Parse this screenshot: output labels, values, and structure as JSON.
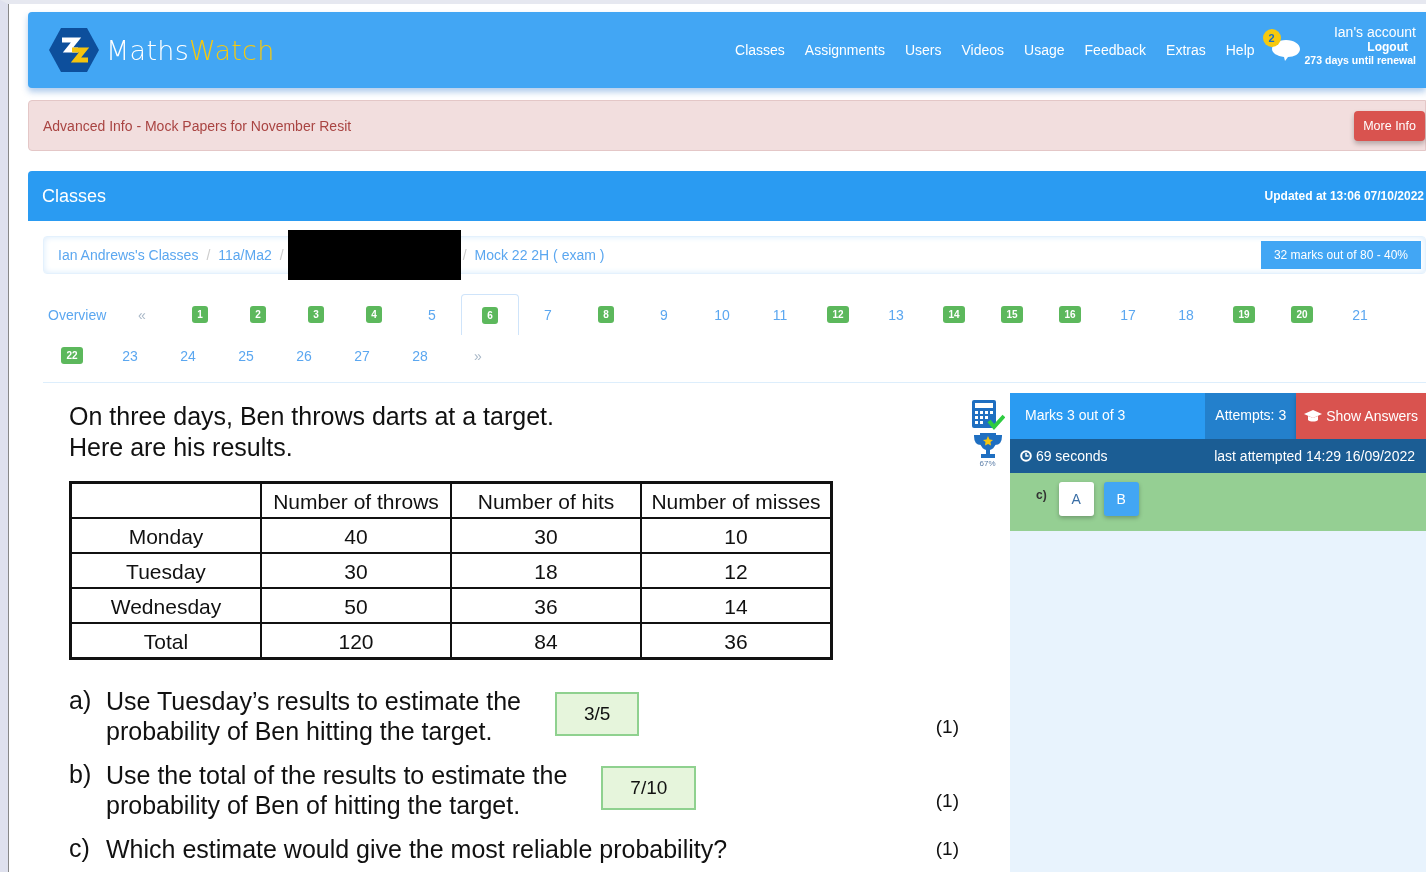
{
  "navbar": {
    "logo_left": "Maths",
    "logo_right": "Watch",
    "links": [
      "Classes",
      "Assignments",
      "Users",
      "Videos",
      "Usage",
      "Feedback",
      "Extras",
      "Help"
    ],
    "message_count": "2",
    "account": "Ian's account",
    "logout": "Logout",
    "renewal": "273 days until renewal"
  },
  "alert": {
    "text": "Advanced Info - Mock Papers for November Resit",
    "button": "More Info"
  },
  "panel": {
    "title": "Classes",
    "updated": "Updated at 13:06 07/10/2022"
  },
  "breadcrumb": {
    "separator": "/",
    "items": [
      "Ian Andrews's Classes",
      "11a/Ma2",
      "Mock 22 2H ( exam )"
    ],
    "score": "32 marks out of 80 - 40%"
  },
  "pagination": {
    "overview": "Overview",
    "prev": "«",
    "next": "»",
    "questions": [
      {
        "label": "1",
        "answered": true,
        "selected": false
      },
      {
        "label": "2",
        "answered": true,
        "selected": false
      },
      {
        "label": "3",
        "answered": true,
        "selected": false
      },
      {
        "label": "4",
        "answered": true,
        "selected": false
      },
      {
        "label": "5",
        "answered": false,
        "selected": false
      },
      {
        "label": "6",
        "answered": true,
        "selected": true
      },
      {
        "label": "7",
        "answered": false,
        "selected": false
      },
      {
        "label": "8",
        "answered": true,
        "selected": false
      },
      {
        "label": "9",
        "answered": false,
        "selected": false
      },
      {
        "label": "10",
        "answered": false,
        "selected": false
      },
      {
        "label": "11",
        "answered": false,
        "selected": false
      },
      {
        "label": "12",
        "answered": true,
        "selected": false
      },
      {
        "label": "13",
        "answered": false,
        "selected": false
      },
      {
        "label": "14",
        "answered": true,
        "selected": false
      },
      {
        "label": "15",
        "answered": true,
        "selected": false
      },
      {
        "label": "16",
        "answered": true,
        "selected": false
      },
      {
        "label": "17",
        "answered": false,
        "selected": false
      },
      {
        "label": "18",
        "answered": false,
        "selected": false
      },
      {
        "label": "19",
        "answered": true,
        "selected": false
      },
      {
        "label": "20",
        "answered": true,
        "selected": false
      },
      {
        "label": "21",
        "answered": false,
        "selected": false
      },
      {
        "label": "22",
        "answered": true,
        "selected": false
      },
      {
        "label": "23",
        "answered": false,
        "selected": false
      },
      {
        "label": "24",
        "answered": false,
        "selected": false
      },
      {
        "label": "25",
        "answered": false,
        "selected": false
      },
      {
        "label": "26",
        "answered": false,
        "selected": false
      },
      {
        "label": "27",
        "answered": false,
        "selected": false
      },
      {
        "label": "28",
        "answered": false,
        "selected": false
      }
    ]
  },
  "question": {
    "intro": [
      "On three days, Ben throws darts at a target.",
      "Here are his results."
    ],
    "table": {
      "columns": [
        "Number of throws",
        "Number of hits",
        "Number of misses"
      ],
      "rows": [
        {
          "label": "Monday",
          "values": [
            "40",
            "30",
            "10"
          ]
        },
        {
          "label": "Tuesday",
          "values": [
            "30",
            "18",
            "12"
          ]
        },
        {
          "label": "Wednesday",
          "values": [
            "50",
            "36",
            "14"
          ]
        },
        {
          "label": "Total",
          "values": [
            "120",
            "84",
            "36"
          ]
        }
      ]
    },
    "parts": [
      {
        "letter": "a)",
        "lines": [
          "Use Tuesday’s results to estimate the",
          "probability of Ben hitting the target."
        ],
        "answer": "3/5",
        "marks": "(1)"
      },
      {
        "letter": "b)",
        "lines": [
          "Use the total of the results to estimate the",
          "probability of Ben of hitting the target."
        ],
        "answer": "7/10",
        "marks": "(1)"
      },
      {
        "letter": "c)",
        "lines": [
          "Which estimate would give the most reliable probability?"
        ],
        "marks": "(1)"
      }
    ]
  },
  "tools": {
    "trophy_percent": "67%"
  },
  "result": {
    "marks": "Marks 3 out of 3",
    "attempts": "Attempts: 3",
    "show_answers": "Show Answers",
    "time": "69 seconds",
    "last_attempted": "last attempted 14:29 16/09/2022",
    "part": "c)",
    "options": [
      {
        "label": "A",
        "selected": false
      },
      {
        "label": "B",
        "selected": true
      }
    ]
  }
}
